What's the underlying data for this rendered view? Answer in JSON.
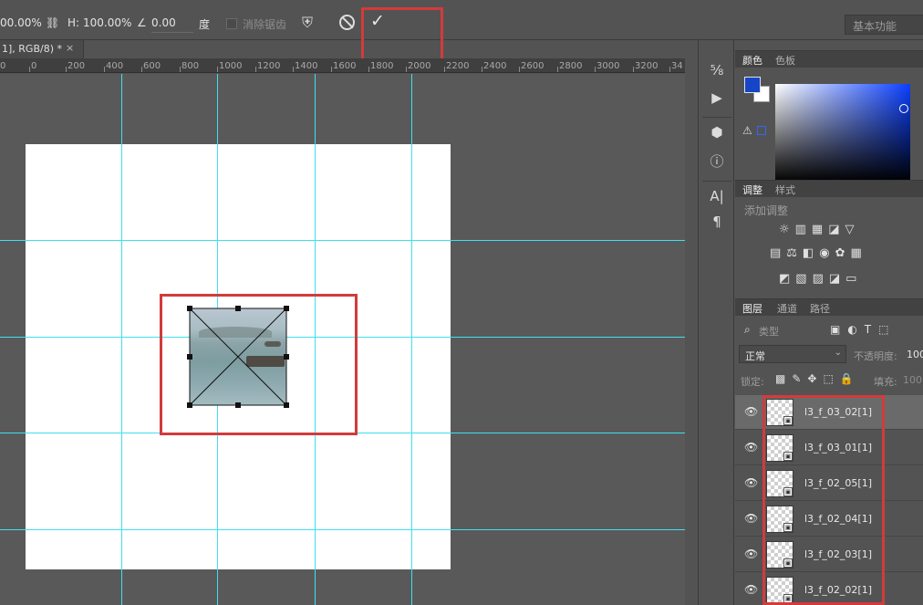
{
  "options_bar": {
    "w_value": "00.00%",
    "h_label": "H:",
    "h_value": "100.00%",
    "angle_value": "0.00",
    "angle_unit": "度",
    "antialias_label": "消除锯齿",
    "workspace": "基本功能"
  },
  "document_tab": {
    "title": "1], RGB/8) *",
    "close": "×"
  },
  "ruler": {
    "labels": [
      "0",
      "0",
      "200",
      "400",
      "600",
      "800",
      "1000",
      "1200",
      "1400",
      "1600",
      "1800",
      "2000",
      "2200",
      "2400",
      "2600",
      "2800",
      "3000",
      "3200",
      "34"
    ]
  },
  "color_panel": {
    "tabs": [
      "颜色",
      "色板"
    ],
    "foreground": "#1645c8",
    "background": "#ffffff"
  },
  "adjustments_panel": {
    "tabs": [
      "调整",
      "样式"
    ],
    "add_label": "添加调整"
  },
  "layers_panel": {
    "tabs": [
      "图层",
      "通道",
      "路径"
    ],
    "filter_label": "类型",
    "blend_mode": "正常",
    "opacity_label": "不透明度:",
    "opacity_value": "100",
    "lock_label": "锁定:",
    "fill_label": "填充:",
    "fill_value": "100",
    "layers": [
      {
        "name": "l3_f_03_02[1]",
        "selected": true
      },
      {
        "name": "l3_f_03_01[1]",
        "selected": false
      },
      {
        "name": "l3_f_02_05[1]",
        "selected": false
      },
      {
        "name": "l3_f_02_04[1]",
        "selected": false
      },
      {
        "name": "l3_f_02_03[1]",
        "selected": false
      },
      {
        "name": "l3_f_02_02[1]",
        "selected": false
      }
    ]
  },
  "colors": {
    "guide": "#3ee0f0",
    "highlight": "#d33b3b"
  }
}
